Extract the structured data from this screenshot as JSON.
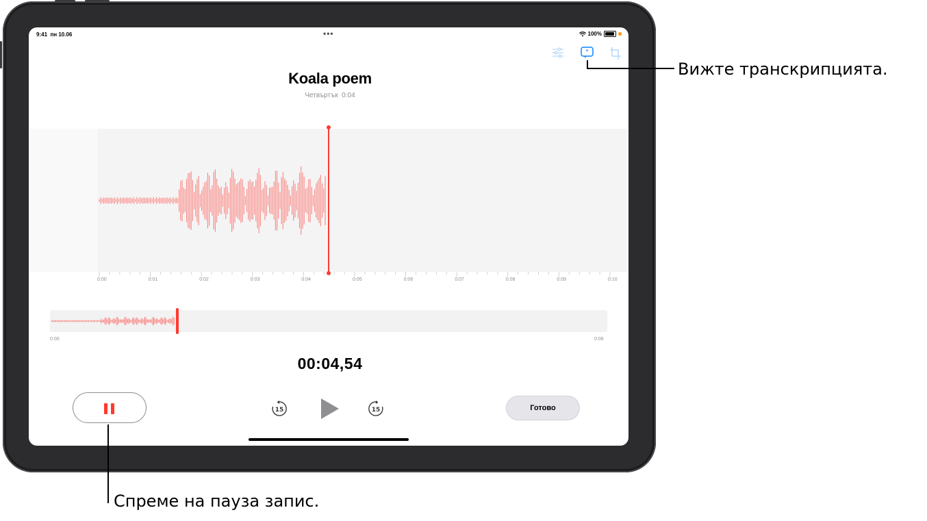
{
  "status_bar": {
    "time": "9:41",
    "date": "пн 10.06",
    "battery": "100%"
  },
  "toolbar": {
    "icons": [
      "sliders-icon",
      "transcript-icon",
      "crop-icon"
    ]
  },
  "recording": {
    "title": "Koala poem",
    "day": "Четвъртък",
    "duration": "0:04"
  },
  "timeline": {
    "ticks": [
      "0:00",
      "0:01",
      "0:02",
      "0:03",
      "0:04",
      "0:05",
      "0:06",
      "0:07",
      "0:08",
      "0:09",
      "0:10"
    ],
    "playhead_seconds": 4.54
  },
  "overview": {
    "start_label": "0:00",
    "end_label": "0:06"
  },
  "timer": "00:04,54",
  "controls": {
    "skip_back": "15",
    "skip_forward": "15",
    "done_label": "Готово"
  },
  "callouts": {
    "transcript": "Вижте транскрипцията.",
    "pause": "Спреме на пауза запис."
  },
  "colors": {
    "accent": "#ff3b30",
    "toolbar_blue": "#0a84ff",
    "wave": "#ff3b30"
  }
}
